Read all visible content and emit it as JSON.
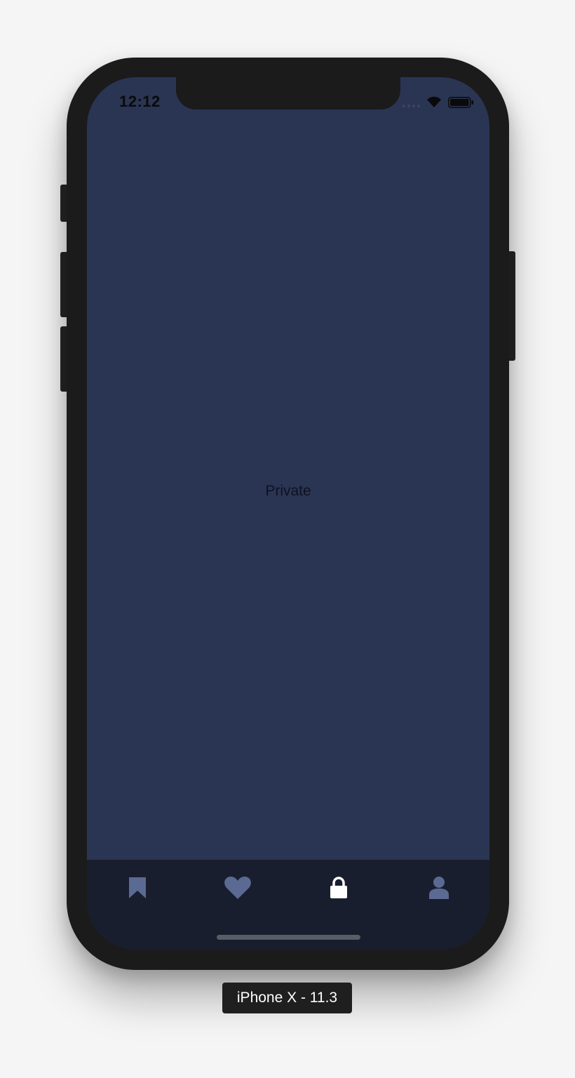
{
  "status_bar": {
    "time": "12:12"
  },
  "content": {
    "label": "Private"
  },
  "tab_bar": {
    "active_index": 2,
    "items": [
      {
        "icon": "bookmark-icon",
        "active": false
      },
      {
        "icon": "heart-icon",
        "active": false
      },
      {
        "icon": "lock-icon",
        "active": true
      },
      {
        "icon": "user-icon",
        "active": false
      }
    ]
  },
  "simulator": {
    "device_label": "iPhone X - 11.3"
  },
  "colors": {
    "screen_background": "#2a3553",
    "tab_bar_background": "#191e2e",
    "tab_icon_inactive": "#5b6a93",
    "tab_icon_active": "#ffffff",
    "device_frame": "#1b1b1b"
  }
}
